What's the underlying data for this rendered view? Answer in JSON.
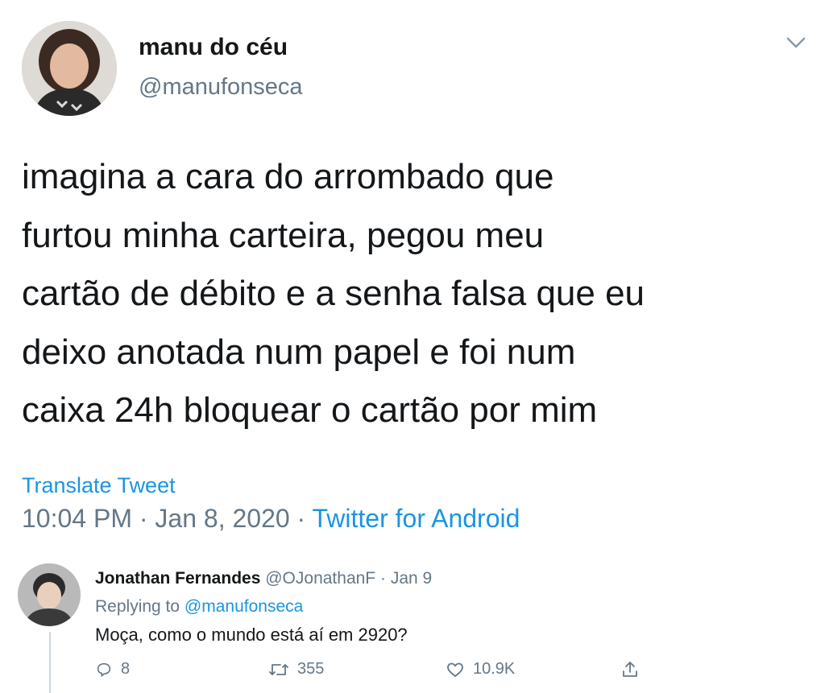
{
  "tweet": {
    "display_name": "manu do céu",
    "handle": "@manufonseca",
    "text_lines": [
      "imagina a cara do arrombado que",
      "furtou minha carteira, pegou meu",
      "cartão de débito e a senha falsa que eu",
      "deixo anotada num papel e foi num",
      "caixa 24h bloquear o cartão por mim"
    ],
    "translate_label": "Translate Tweet",
    "time": "10:04 PM",
    "date": "Jan 8, 2020",
    "separator": "·",
    "source": "Twitter for Android",
    "menu_icon": "chevron-down-icon"
  },
  "reply": {
    "display_name": "Jonathan Fernandes",
    "handle": "@OJonathanF",
    "separator": "·",
    "date": "Jan 9",
    "replying_prefix": "Replying to",
    "replying_to": "@manufonseca",
    "text": "Moça, como o mundo está aí em 2920?",
    "actions": {
      "reply_count": "8",
      "retweet_count": "355",
      "like_count": "10.9K"
    }
  },
  "colors": {
    "text": "#14171a",
    "secondary": "#657786",
    "link": "#1b95e0",
    "divider": "#ccd6dd"
  }
}
